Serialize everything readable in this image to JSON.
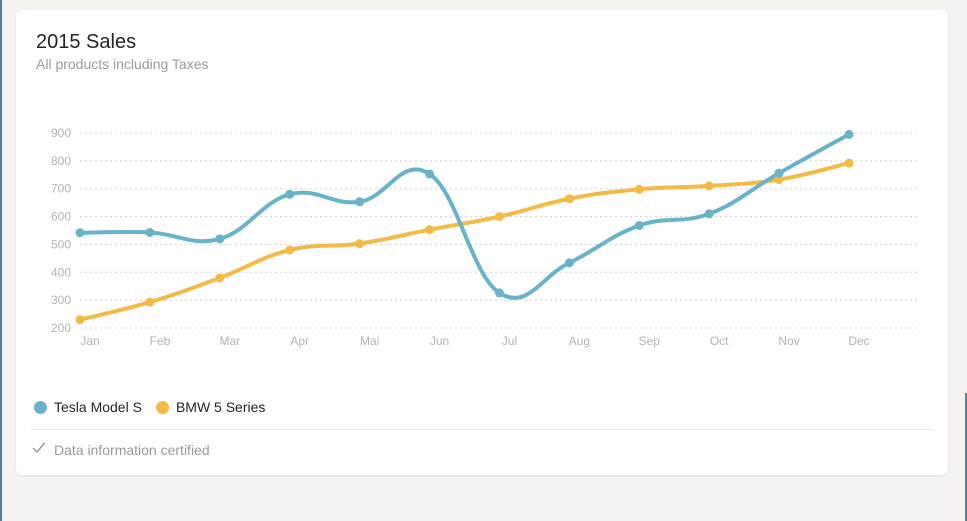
{
  "card": {
    "title": "2015 Sales",
    "subtitle": "All products including Taxes",
    "footer_text": "Data information certified",
    "footer_icon": "check-icon"
  },
  "colors": {
    "tesla": "#68b3c8",
    "bmw": "#f3bb45",
    "grid": "#d0d0d0",
    "tick_text": "#b3b3b3"
  },
  "chart_data": {
    "type": "line",
    "title": "2015 Sales",
    "subtitle": "All products including Taxes",
    "xlabel": "",
    "ylabel": "",
    "categories": [
      "Jan",
      "Feb",
      "Mar",
      "Apr",
      "Mai",
      "Jun",
      "Jul",
      "Aug",
      "Sep",
      "Oct",
      "Nov",
      "Dec"
    ],
    "ylim": [
      200,
      900
    ],
    "yticks": [
      200,
      300,
      400,
      500,
      600,
      700,
      800,
      900
    ],
    "grid": "horizontal dotted",
    "legend_position": "bottom-left",
    "series": [
      {
        "name": "Tesla Model S",
        "color": "#68b3c8",
        "values": [
          542,
          543,
          520,
          680,
          653,
          753,
          326,
          434,
          568,
          610,
          756,
          895
        ]
      },
      {
        "name": "BMW 5 Series",
        "color": "#f3bb45",
        "values": [
          230,
          293,
          380,
          480,
          503,
          553,
          600,
          664,
          698,
          710,
          733,
          792
        ]
      }
    ]
  }
}
